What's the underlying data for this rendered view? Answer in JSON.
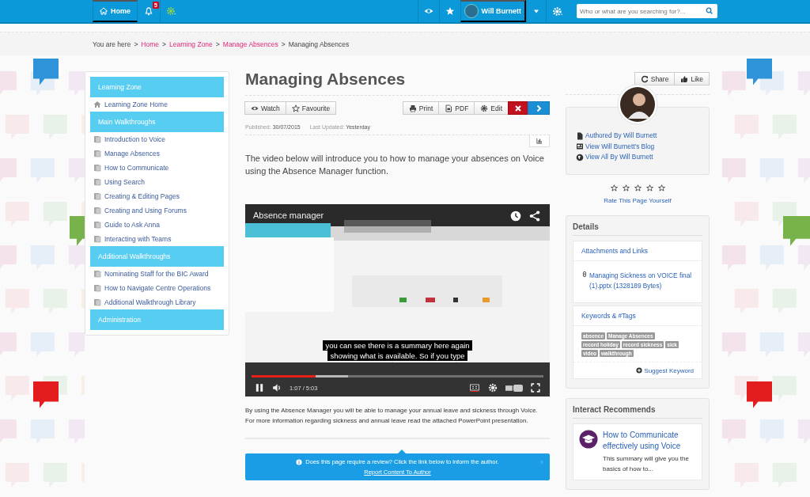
{
  "topbar": {
    "home": "Home",
    "notification_count": "5",
    "user_name": "Will Burnett",
    "search": {
      "placeholder": "Who or what are you searching for?..."
    }
  },
  "breadcrumb": [
    {
      "kind": "plain",
      "text": "You are here"
    },
    {
      "kind": "sep",
      "text": ">"
    },
    {
      "kind": "link",
      "text": "Home"
    },
    {
      "kind": "sep",
      "text": ">"
    },
    {
      "kind": "link",
      "text": "Learning Zone"
    },
    {
      "kind": "sep",
      "text": ">"
    },
    {
      "kind": "link",
      "text": "Manage Absences"
    },
    {
      "kind": "sep",
      "text": ">"
    },
    {
      "kind": "plain",
      "text": "Managing Absences"
    }
  ],
  "sidebar": {
    "sections": [
      {
        "title": "Learning Zone",
        "items": [
          {
            "label": "Learning Zone Home",
            "kind": "home"
          }
        ]
      },
      {
        "title": "Main Walkthroughs",
        "items": [
          {
            "label": "Introduction to Voice",
            "kind": "page"
          },
          {
            "label": "Manage Absences",
            "kind": "page"
          },
          {
            "label": "How to Communicate",
            "kind": "page"
          },
          {
            "label": "Using Search",
            "kind": "page"
          },
          {
            "label": "Creating & Editing Pages",
            "kind": "page"
          },
          {
            "label": "Creating and Using Forums",
            "kind": "page"
          },
          {
            "label": "Guide to Ask Anna",
            "kind": "page"
          },
          {
            "label": "Interacting with Teams",
            "kind": "page"
          }
        ]
      },
      {
        "title": "Additional Walkthroughs",
        "items": [
          {
            "label": "Nominating Staff for the BIC Award",
            "kind": "page"
          },
          {
            "label": "How to Navigate Centre Operations",
            "kind": "page"
          },
          {
            "label": "Additional Walkthrough Library",
            "kind": "page"
          }
        ]
      },
      {
        "title": "Administration"
      }
    ]
  },
  "page": {
    "title": "Managing Absences",
    "left_actions": [
      {
        "label": "Watch",
        "kind": "watch"
      },
      {
        "label": "Favourite",
        "kind": "favourite"
      }
    ],
    "right_actions": [
      {
        "label": "Print",
        "kind": "print"
      },
      {
        "label": "PDF",
        "kind": "pdf"
      },
      {
        "label": "Edit",
        "kind": "edit"
      },
      {
        "kind": "delete"
      },
      {
        "kind": "next"
      }
    ],
    "published_label": "Published:",
    "published": "30/07/2015",
    "updated_label": "Last Updated:",
    "updated": "Yesterday",
    "intro": "The video below will introduce you to how to manage your absences on Voice using the Absence Manager function.",
    "video": {
      "title": "Absence manager",
      "captions": [
        "you can see there is a summary here again",
        "showing what is available. So if you type"
      ],
      "time": "1:07 / 5:03",
      "progress": {
        "level": 0.22
      },
      "buffered": {
        "level": 0.33
      }
    },
    "body": [
      "By using the Absence Manager you will be able to manage your annual leave and sickness through Voice.",
      "For more information regarding sickness and annual leave read the attached PowerPoint presentation."
    ],
    "review": {
      "text": "Does this page require a review? Click the link below to inform the author.",
      "link": "Report Content To Author",
      "close": "x"
    }
  },
  "right": {
    "share": "Share",
    "like": "Like",
    "author_links": [
      {
        "label": "Authored By Will Burnett",
        "kind": "doc"
      },
      {
        "label": "View Will Burnett's Blog",
        "kind": "blog"
      },
      {
        "label": "View All By Will Burnett",
        "kind": "globe"
      }
    ],
    "rating": {
      "stars": 0,
      "label": "Rate This Page Yourself"
    },
    "details": {
      "title": "Details",
      "attachments_title": "Attachments and Links",
      "attachment": "Managing Sickness on VOICE final (1).pptx (1328189 Bytes)",
      "keywords_title": "Keywords & #Tags",
      "tags": [
        "absence",
        "Manage Absences",
        "record holiday",
        "record sickness",
        "sick",
        "video",
        "walkthrough"
      ],
      "suggest": "Suggest Keyword"
    },
    "recommends": {
      "title": "Interact Recommends",
      "item_title": "How to Communicate effectively using Voice",
      "item_summary": "This summary will give you the basics of how to..."
    }
  }
}
